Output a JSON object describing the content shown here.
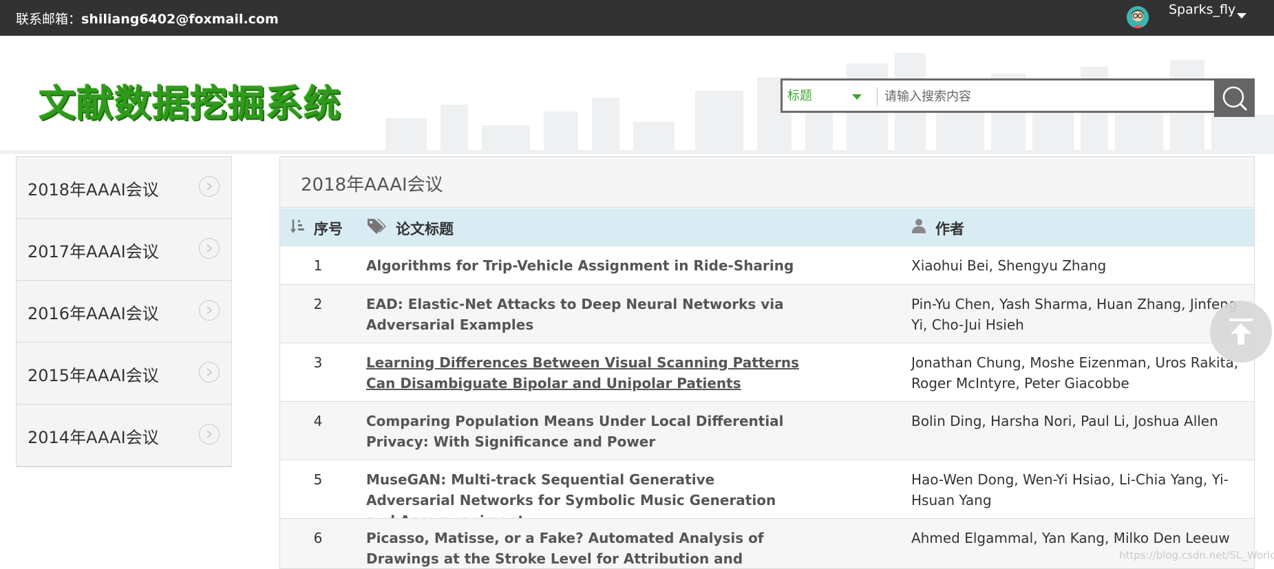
{
  "topbar": {
    "contact_label": "联系邮箱：",
    "contact_email": "shiliang6402@foxmail.com",
    "username": "Sparks_fly"
  },
  "header": {
    "logo_text": "文献数据挖掘系统",
    "search_type": "标题",
    "search_placeholder": "请输入搜索内容"
  },
  "sidebar": {
    "items": [
      {
        "label": "2018年AAAI会议"
      },
      {
        "label": "2017年AAAI会议"
      },
      {
        "label": "2016年AAAI会议"
      },
      {
        "label": "2015年AAAI会议"
      },
      {
        "label": "2014年AAAI会议"
      }
    ]
  },
  "main": {
    "title": "2018年AAAI会议",
    "columns": {
      "num": "序号",
      "title": "论文标题",
      "author": "作者"
    },
    "rows": [
      {
        "num": "1",
        "title": "Algorithms for Trip-Vehicle Assignment in Ride-Sharing",
        "authors": "Xiaohui Bei, Shengyu Zhang"
      },
      {
        "num": "2",
        "title": "EAD: Elastic-Net Attacks to Deep Neural Networks via Adversarial Examples",
        "authors": "Pin-Yu Chen, Yash Sharma, Huan Zhang, Jinfeng Yi, Cho-Jui Hsieh"
      },
      {
        "num": "3",
        "title": "Learning Differences Between Visual Scanning Patterns Can Disambiguate Bipolar and Unipolar Patients",
        "authors": "Jonathan Chung, Moshe Eizenman, Uros Rakita, Roger McIntyre, Peter Giacobbe"
      },
      {
        "num": "4",
        "title": "Comparing Population Means Under Local Differential Privacy: With Significance and Power",
        "authors": "Bolin Ding, Harsha Nori, Paul Li, Joshua Allen"
      },
      {
        "num": "5",
        "title": "MuseGAN: Multi-track Sequential Generative Adversarial Networks for Symbolic Music Generation and Accompaniment",
        "authors": "Hao-Wen Dong, Wen-Yi Hsiao, Li-Chia Yang, Yi-Hsuan Yang"
      },
      {
        "num": "6",
        "title": "Picasso, Matisse, or a Fake? Automated Analysis of Drawings at the Stroke Level for Attribution and Authentication",
        "authors": "Ahmed Elgammal, Yan Kang, Milko Den Leeuw"
      }
    ]
  },
  "watermark": "https://blog.csdn.net/SL_World",
  "colors": {
    "topbar_bg": "#323232",
    "logo_green": "#2f9a1c",
    "table_header_bg": "#d9ecf3",
    "search_type_green": "#3ea432"
  },
  "icons": {
    "avatar": "avatar-icon",
    "user_menu_caret": "chevron-down-icon",
    "search_type_caret": "caret-down-icon",
    "search_button": "search-icon",
    "sidebar_arrow": "chevron-right-circle-icon",
    "sort_column": "sort-icon",
    "title_column": "tags-icon",
    "author_column": "user-icon",
    "back_to_top": "arrow-up-icon"
  }
}
